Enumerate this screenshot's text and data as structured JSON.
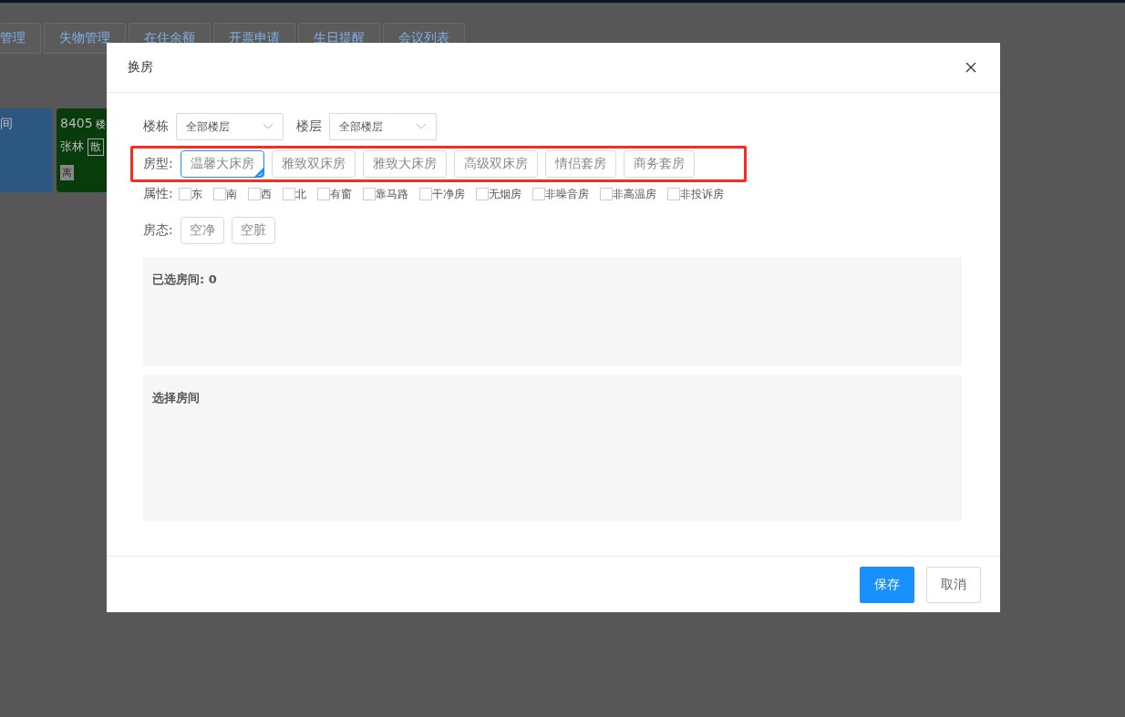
{
  "background": {
    "tabs": [
      {
        "label": "管理"
      },
      {
        "label": "失物管理"
      },
      {
        "label": "在住余额"
      },
      {
        "label": "开票申请"
      },
      {
        "label": "生日提醒"
      },
      {
        "label": "会议列表"
      }
    ],
    "cards": [
      {
        "kind": "blue",
        "number": "间"
      },
      {
        "kind": "green",
        "number": "8405",
        "building": "楼",
        "guest": "张林",
        "tag": "散",
        "status": "离"
      }
    ]
  },
  "dialog": {
    "title": "换房",
    "filters": [
      {
        "label": "楼栋",
        "value": "全部楼层"
      },
      {
        "label": "楼层",
        "value": "全部楼层"
      }
    ],
    "room_types": {
      "label": "房型:",
      "items": [
        {
          "label": "温馨大床房",
          "selected": true
        },
        {
          "label": "雅致双床房",
          "selected": false
        },
        {
          "label": "雅致大床房",
          "selected": false
        },
        {
          "label": "高级双床房",
          "selected": false
        },
        {
          "label": "情侣套房",
          "selected": false
        },
        {
          "label": "商务套房",
          "selected": false
        }
      ]
    },
    "attributes": {
      "label": "属性:",
      "items": [
        {
          "label": "东",
          "checked": false
        },
        {
          "label": "南",
          "checked": false
        },
        {
          "label": "西",
          "checked": false
        },
        {
          "label": "北",
          "checked": false
        },
        {
          "label": "有窗",
          "checked": false
        },
        {
          "label": "靠马路",
          "checked": false
        },
        {
          "label": "干净房",
          "checked": false
        },
        {
          "label": "无烟房",
          "checked": false
        },
        {
          "label": "非噪音房",
          "checked": false
        },
        {
          "label": "非高温房",
          "checked": false
        },
        {
          "label": "非投诉房",
          "checked": false
        }
      ]
    },
    "room_states": {
      "label": "房态:",
      "items": [
        {
          "label": "空净",
          "selected": false
        },
        {
          "label": "空脏",
          "selected": false
        }
      ]
    },
    "panels": [
      {
        "title": "已选房间: 0"
      },
      {
        "title": "选择房间"
      }
    ],
    "buttons": [
      {
        "label": "保存",
        "kind": "primary"
      },
      {
        "label": "取消",
        "kind": "default"
      }
    ]
  }
}
